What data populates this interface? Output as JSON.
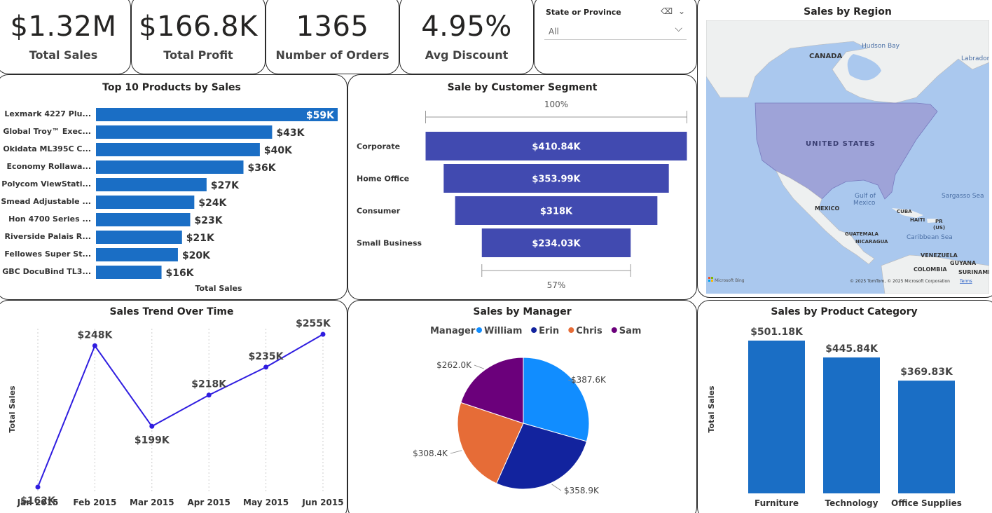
{
  "kpis": [
    {
      "value": "$1.32M",
      "label": "Total Sales"
    },
    {
      "value": "$166.8K",
      "label": "Total Profit"
    },
    {
      "value": "1365",
      "label": "Number of Orders"
    },
    {
      "value": "4.95%",
      "label": "Avg Discount"
    }
  ],
  "slicer": {
    "title": "State or Province",
    "value": "All",
    "eraser_icon": "eraser-icon",
    "chevron_icon": "chevron-down-icon"
  },
  "map": {
    "title": "Sales by Region",
    "labels": {
      "canada": "CANADA",
      "hudson": "Hudson Bay",
      "labrador": "Labrador S",
      "us": "UNITED STATES",
      "gulf": "Gulf of",
      "gulf2": "Mexico",
      "mexico": "MEXICO",
      "cuba": "CUBA",
      "haiti": "HAITI",
      "pr": "PR",
      "pr2": "(US)",
      "sargasso": "Sargasso Sea",
      "guatemala": "GUATEMALA",
      "nicaragua": "NICARAGUA",
      "caribbean": "Caribbean Sea",
      "venezuela": "VENEZUELA",
      "colombia": "COLOMBIA",
      "guyana": "GUYANA",
      "suriname": "SURINAME"
    },
    "bing": "Microsoft Bing",
    "copyright": "© 2025 TomTom, © 2025 Microsoft Corporation",
    "terms": "Terms"
  },
  "chart_data": [
    {
      "type": "bar",
      "orientation": "horizontal",
      "title": "Top 10 Products by Sales",
      "xlabel": "Total Sales",
      "categories": [
        "Lexmark 4227 Plu...",
        "Global Troy™ Exec...",
        "Okidata ML395C C...",
        "Economy Rollawa...",
        "Polycom ViewStati...",
        "Smead Adjustable ...",
        "Hon 4700 Series ...",
        "Riverside Palais R...",
        "Fellowes Super St...",
        "GBC DocuBind TL3..."
      ],
      "values": [
        59,
        43,
        40,
        36,
        27,
        24,
        23,
        21,
        20,
        16
      ],
      "data_labels": [
        "$59K",
        "$43K",
        "$40K",
        "$36K",
        "$27K",
        "$24K",
        "$23K",
        "$21K",
        "$20K",
        "$16K"
      ],
      "color": "#1a6ec5"
    },
    {
      "type": "funnel",
      "title": "Sale by Customer Segment",
      "categories": [
        "Corporate",
        "Home Office",
        "Consumer",
        "Small Business"
      ],
      "values": [
        410.84,
        353.99,
        318,
        234.03
      ],
      "data_labels": [
        "$410.84K",
        "$353.99K",
        "$318K",
        "$234.03K"
      ],
      "top_percent": "100%",
      "bottom_percent": "57%",
      "color": "#414ab0"
    },
    {
      "type": "line",
      "title": "Sales Trend Over Time",
      "ylabel": "Total Sales",
      "x": [
        "Jan 2015",
        "Feb 2015",
        "Mar 2015",
        "Apr 2015",
        "May 2015",
        "Jun 2015"
      ],
      "values": [
        162,
        248,
        199,
        218,
        235,
        255
      ],
      "data_labels": [
        "$162K",
        "$248K",
        "$199K",
        "$218K",
        "$235K",
        "$255K"
      ],
      "color": "#2f1de0"
    },
    {
      "type": "pie",
      "title": "Sales by Manager",
      "legend_title": "Manager",
      "legend_position": "top",
      "series": [
        {
          "name": "William",
          "value": 387.6,
          "label": "$387.6K",
          "color": "#118dff"
        },
        {
          "name": "Erin",
          "value": 358.9,
          "label": "$358.9K",
          "color": "#12239e"
        },
        {
          "name": "Chris",
          "value": 308.4,
          "label": "$308.4K",
          "color": "#e66c37"
        },
        {
          "name": "Sam",
          "value": 262.0,
          "label": "$262.0K",
          "color": "#6b007b"
        }
      ]
    },
    {
      "type": "bar",
      "title": "Sales by Product Category",
      "ylabel": "Total Sales",
      "categories": [
        "Furniture",
        "Technology",
        "Office Supplies"
      ],
      "values": [
        501.18,
        445.84,
        369.83
      ],
      "data_labels": [
        "$501.18K",
        "$445.84K",
        "$369.83K"
      ],
      "color": "#1a6ec5"
    }
  ]
}
